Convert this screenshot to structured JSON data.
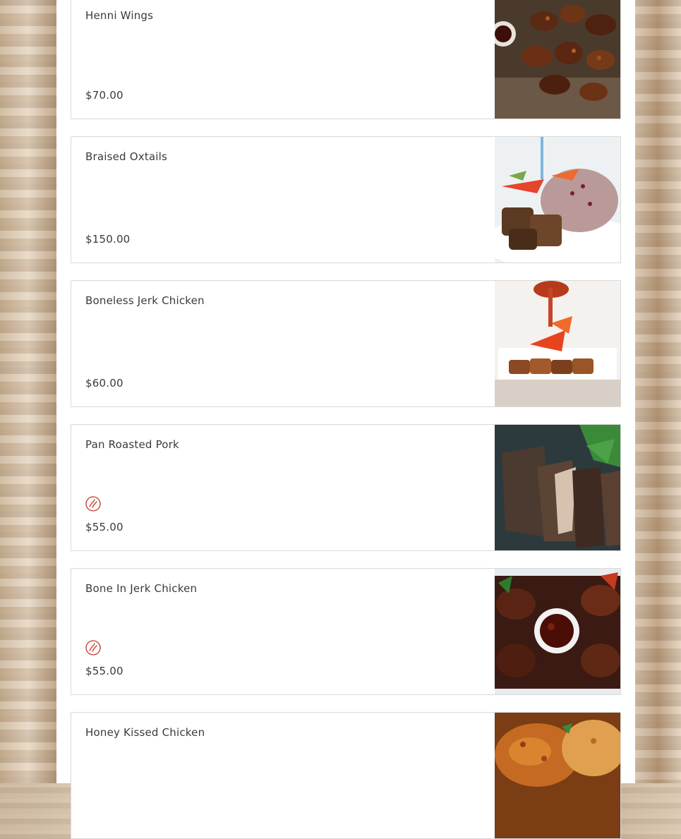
{
  "menu": {
    "items": [
      {
        "name": "Henni Wings",
        "price": "$70.00",
        "spicy": false,
        "image": "wings-image"
      },
      {
        "name": "Braised Oxtails",
        "price": "$150.00",
        "spicy": false,
        "image": "oxtails-image"
      },
      {
        "name": "Boneless Jerk Chicken",
        "price": "$60.00",
        "spicy": false,
        "image": "boneless-jerk-chicken-image"
      },
      {
        "name": "Pan Roasted Pork",
        "price": "$55.00",
        "spicy": true,
        "image": "pan-roasted-pork-image"
      },
      {
        "name": "Bone In Jerk Chicken",
        "price": "$55.00",
        "spicy": true,
        "image": "bone-in-jerk-chicken-image"
      },
      {
        "name": "Honey Kissed Chicken",
        "price": "",
        "spicy": false,
        "image": "honey-kissed-chicken-image"
      }
    ],
    "spicy_icon": "chili-pepper-icon",
    "spicy_color": "#c0392b"
  }
}
